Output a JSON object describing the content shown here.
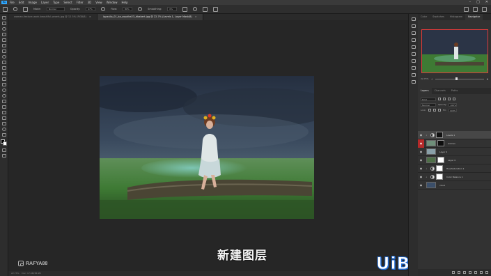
{
  "app": {
    "logo": "Ps"
  },
  "menu": [
    "File",
    "Edit",
    "Image",
    "Layer",
    "Type",
    "Select",
    "Filter",
    "3D",
    "View",
    "Window",
    "Help"
  ],
  "options_bar": {
    "mode_label": "Mode:",
    "mode_value": "Normal",
    "opacity_label": "Opacity:",
    "opacity_value": "47%",
    "flow_label": "Flow:",
    "flow_value": "80%",
    "smoothing_label": "Smoothing:",
    "smoothing_value": "0%"
  },
  "tabs": [
    {
      "label": "woman-feature-work-beautiful-pexels.jpg @ 12.5% (RGB/8)",
      "active": false
    },
    {
      "label": "Ipyaullo_01_ka_assaibe23_dbabert.jpg @ 22.7% (Levels 1, Layer Mask/8)",
      "active": true
    }
  ],
  "status_bar": {
    "zoom_text": "22.73%",
    "doc_text": "Doc: 17.9M/38.9M"
  },
  "subtitle": "新建图层",
  "watermark_left": "RAFYA88",
  "watermark_right": "UiBQ.CoM",
  "panels": {
    "top_tabs": [
      "Color",
      "Swatches",
      "Histogram",
      "Navigator"
    ],
    "top_active": "Navigator",
    "nav_zoom": "22.73%",
    "layer_tabs": [
      "Layers",
      "Channels",
      "Paths"
    ],
    "layer_active": "Layers",
    "kind_label": "Kind",
    "blend_mode": "Normal",
    "opacity_label": "Opacity:",
    "opacity_value": "100%",
    "lock_label": "Lock:",
    "fill_label": "Fill:",
    "fill_value": "100%"
  },
  "layers": [
    {
      "name": "Levels 1",
      "type": "adjustment",
      "selected": true,
      "eye_red": false
    },
    {
      "name": "woman",
      "type": "image",
      "selected": false,
      "eye_red": true
    },
    {
      "name": "Layer 2",
      "type": "image",
      "selected": false,
      "eye_red": false
    },
    {
      "name": "Layer 0",
      "type": "image",
      "selected": false,
      "eye_red": false
    },
    {
      "name": "Hue/Saturation 1",
      "type": "adjustment",
      "selected": false,
      "eye_red": false
    },
    {
      "name": "Color Balance 1",
      "type": "adjustment",
      "selected": false,
      "eye_red": false
    },
    {
      "name": "cloud",
      "type": "image",
      "selected": false,
      "eye_red": false
    }
  ],
  "colors": {
    "accent": "#31a8ff",
    "grass": "#3e7a34",
    "sky": "#2d3a4c"
  }
}
